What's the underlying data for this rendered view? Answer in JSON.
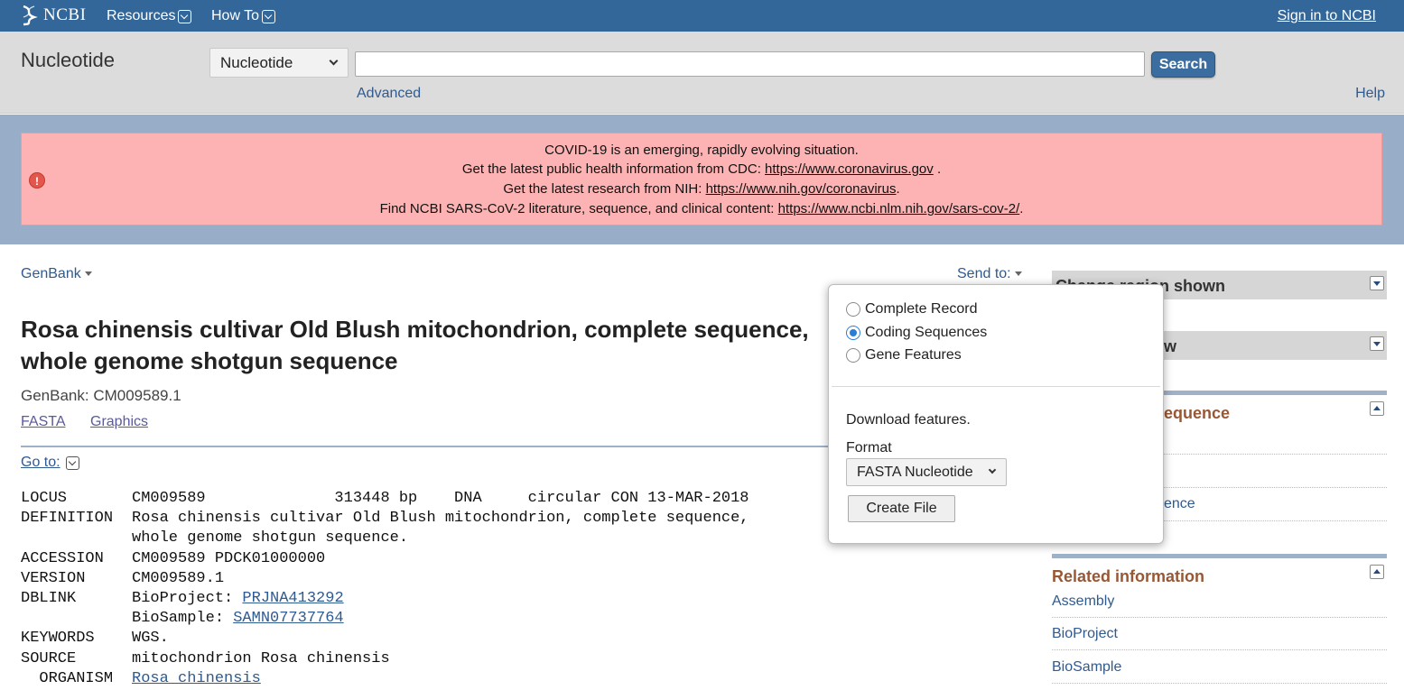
{
  "header": {
    "logo_text": "NCBI",
    "resources_label": "Resources",
    "howto_label": "How To",
    "signin_label": "Sign in to NCBI"
  },
  "search": {
    "db_title": "Nucleotide",
    "db_select_value": "Nucleotide",
    "query": "",
    "search_button": "Search",
    "advanced_link": "Advanced",
    "help_link": "Help"
  },
  "alert": {
    "line1": "COVID-19 is an emerging, rapidly evolving situation.",
    "line2_text": "Get the latest public health information from CDC: ",
    "line2_link": "https://www.coronavirus.gov",
    "line2_end": " .",
    "line3_text": "Get the latest research from NIH: ",
    "line3_link": "https://www.nih.gov/coronavirus",
    "line3_end": ".",
    "line4_text": "Find NCBI SARS-CoV-2 literature, sequence, and clinical content: ",
    "line4_link": "https://www.ncbi.nlm.nih.gov/sars-cov-2/",
    "line4_end": "."
  },
  "record": {
    "format_menu": "GenBank",
    "send_to": "Send to:",
    "title": "Rosa chinensis cultivar Old Blush mitochondrion, complete sequence, whole genome shotgun sequence",
    "accession_line": "GenBank: CM009589.1",
    "fasta_link": "FASTA",
    "graphics_link": "Graphics",
    "goto_label": "Go to:"
  },
  "flatfile": {
    "locus_key": "LOCUS",
    "locus_val": "CM009589              313448 bp    DNA     circular CON 13-MAR-2018",
    "definition_key": "DEFINITION",
    "definition_val1": "Rosa chinensis cultivar Old Blush mitochondrion, complete sequence,",
    "definition_val2": "whole genome shotgun sequence.",
    "accession_key": "ACCESSION",
    "accession_val": "CM009589 PDCK01000000",
    "version_key": "VERSION",
    "version_val": "CM009589.1",
    "dblink_key": "DBLINK",
    "bioproject_label": "BioProject: ",
    "bioproject_link": "PRJNA413292",
    "biosample_label": "BioSample: ",
    "biosample_link": "SAMN07737764",
    "keywords_key": "KEYWORDS",
    "keywords_val": "WGS.",
    "source_key": "SOURCE",
    "source_val": "mitochondrion Rosa chinensis",
    "organism_key": "  ORGANISM",
    "organism_link": "Rosa chinensis"
  },
  "popup": {
    "options": [
      "Complete Record",
      "Coding Sequences",
      "Gene Features"
    ],
    "selected": "Coding Sequences",
    "download_text": "Download features.",
    "format_label": "Format",
    "format_value": "FASTA Nucleotide",
    "create_button": "Create File"
  },
  "sidebar": {
    "change_region_header": "Change region shown",
    "customize_header_fragment": "w",
    "analyze_heading_fragment": "equence",
    "analyze_link_fragment": "ence",
    "related_heading": "Related information",
    "related_links": [
      "Assembly",
      "BioProject",
      "BioSample"
    ]
  }
}
